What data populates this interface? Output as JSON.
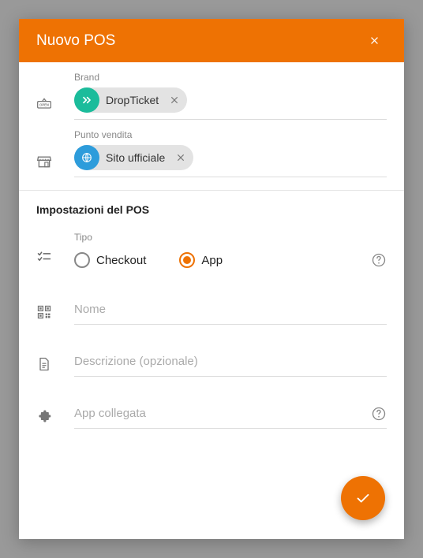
{
  "header": {
    "title": "Nuovo POS"
  },
  "brand": {
    "label": "Brand",
    "chip_label": "DropTicket"
  },
  "venue": {
    "label": "Punto vendita",
    "chip_label": "Sito ufficiale"
  },
  "settings": {
    "section_title": "Impostazioni del POS"
  },
  "tipo": {
    "label": "Tipo",
    "options": {
      "checkout": "Checkout",
      "app": "App"
    },
    "selected": "app"
  },
  "fields": {
    "name_placeholder": "Nome",
    "description_placeholder": "Descrizione (opzionale)",
    "app_placeholder": "App collegata"
  },
  "colors": {
    "accent": "#ee7203",
    "chip_green": "#1bbc9b",
    "chip_blue": "#2d9cdb"
  }
}
